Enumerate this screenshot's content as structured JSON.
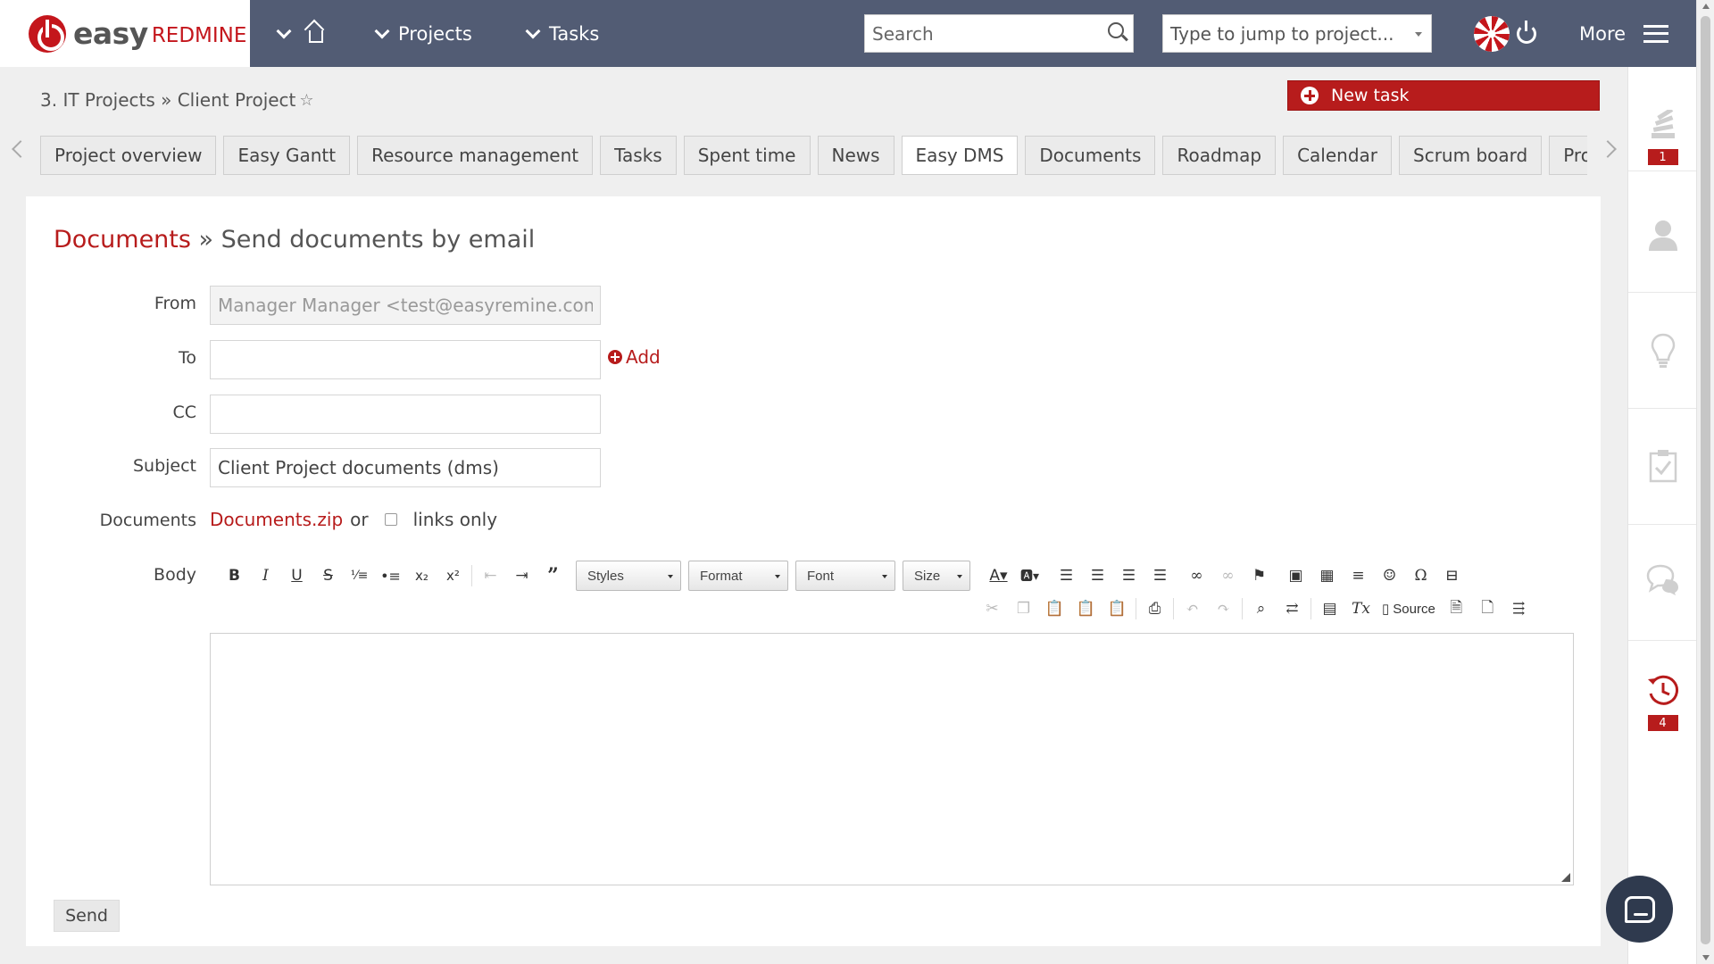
{
  "app": {
    "logo_easy": "easy",
    "logo_redmine": "REDMINE"
  },
  "topnav": {
    "projects_label": "Projects",
    "tasks_label": "Tasks",
    "search_placeholder": "Search",
    "jump_placeholder": "Type to jump to project...",
    "more_label": "More"
  },
  "breadcrumb": {
    "path": "3. IT Projects » Client Project",
    "star": "☆"
  },
  "new_task_label": "New task",
  "tabs": [
    "Project overview",
    "Easy Gantt",
    "Resource management",
    "Tasks",
    "Spent time",
    "News",
    "Easy DMS",
    "Documents",
    "Roadmap",
    "Calendar",
    "Scrum board",
    "Project calculation"
  ],
  "active_tab": "Easy DMS",
  "page": {
    "title_link": "Documents",
    "title_sep": " » ",
    "title_rest": "Send documents by email"
  },
  "form": {
    "from_label": "From",
    "from_value": "Manager Manager <test@easyremine.com>",
    "to_label": "To",
    "to_value": "",
    "add_label": "Add",
    "cc_label": "CC",
    "cc_value": "",
    "subject_label": "Subject",
    "subject_value": "Client Project documents (dms)",
    "documents_label": "Documents",
    "documents_zip": "Documents.zip",
    "documents_or": "or",
    "links_only": "links only",
    "links_only_checked": false,
    "body_label": "Body",
    "send_label": "Send"
  },
  "editor_toolbar": {
    "styles": "Styles",
    "format": "Format",
    "font": "Font",
    "size": "Size",
    "source": "Source"
  },
  "sidebar": {
    "activity_badge": "1",
    "history_badge": "4"
  },
  "colors": {
    "brand_red": "#b71c1c",
    "topbar": "#525c74"
  }
}
